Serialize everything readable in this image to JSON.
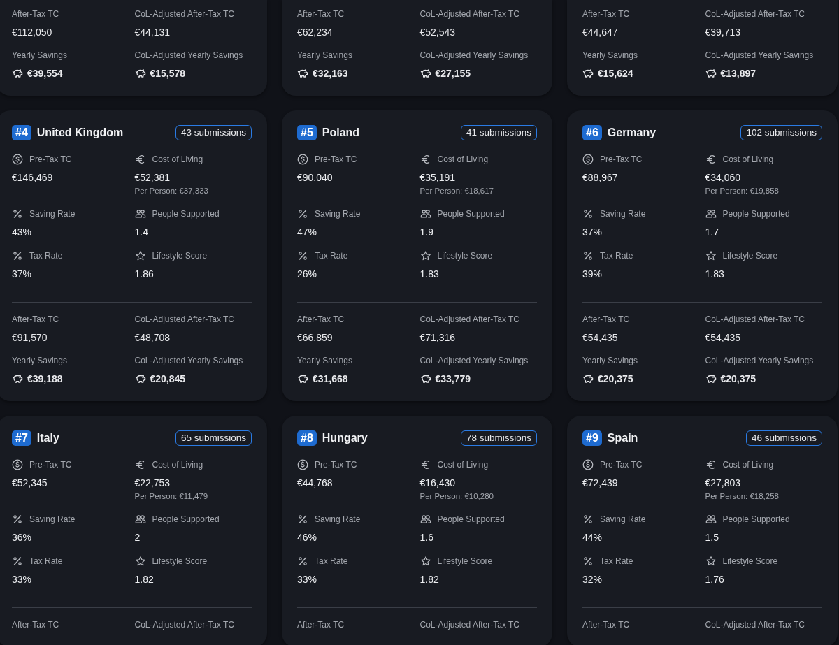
{
  "cards": [
    {
      "summary": [
        {
          "label": "After-Tax TC",
          "value": "€112,050",
          "kind": "amount"
        },
        {
          "label": "CoL-Adjusted After-Tax TC",
          "value": "€44,131",
          "kind": "amount"
        },
        {
          "label": "Yearly Savings",
          "value": "€39,554",
          "kind": "savings"
        },
        {
          "label": "CoL-Adjusted Yearly Savings",
          "value": "€15,578",
          "kind": "savings"
        }
      ]
    },
    {
      "summary": [
        {
          "label": "After-Tax TC",
          "value": "€62,234",
          "kind": "amount"
        },
        {
          "label": "CoL-Adjusted After-Tax TC",
          "value": "€52,543",
          "kind": "amount"
        },
        {
          "label": "Yearly Savings",
          "value": "€32,163",
          "kind": "savings"
        },
        {
          "label": "CoL-Adjusted Yearly Savings",
          "value": "€27,155",
          "kind": "savings"
        }
      ]
    },
    {
      "summary": [
        {
          "label": "After-Tax TC",
          "value": "€44,647",
          "kind": "amount"
        },
        {
          "label": "CoL-Adjusted After-Tax TC",
          "value": "€39,713",
          "kind": "amount"
        },
        {
          "label": "Yearly Savings",
          "value": "€15,624",
          "kind": "savings"
        },
        {
          "label": "CoL-Adjusted Yearly Savings",
          "value": "€13,897",
          "kind": "savings"
        }
      ]
    },
    {
      "rank": "#4",
      "country": "United Kingdom",
      "submissions": "43 submissions",
      "metrics": [
        {
          "kind": "amount",
          "label": "Pre-Tax TC",
          "value": "€146,469"
        },
        {
          "kind": "cost",
          "label": "Cost of Living",
          "value": "€52,381",
          "note": "Per Person: €37,333"
        },
        {
          "kind": "rate",
          "label": "Saving Rate",
          "value": "43%"
        },
        {
          "kind": "count",
          "label": "People Supported",
          "value": "1.4"
        },
        {
          "kind": "rate",
          "label": "Tax Rate",
          "value": "37%"
        },
        {
          "kind": "score",
          "label": "Lifestyle Score",
          "value": "1.86"
        }
      ],
      "summary": [
        {
          "label": "After-Tax TC",
          "value": "€91,570",
          "kind": "amount"
        },
        {
          "label": "CoL-Adjusted After-Tax TC",
          "value": "€48,708",
          "kind": "amount"
        },
        {
          "label": "Yearly Savings",
          "value": "€39,188",
          "kind": "savings"
        },
        {
          "label": "CoL-Adjusted Yearly Savings",
          "value": "€20,845",
          "kind": "savings"
        }
      ]
    },
    {
      "rank": "#5",
      "country": "Poland",
      "submissions": "41 submissions",
      "metrics": [
        {
          "kind": "amount",
          "label": "Pre-Tax TC",
          "value": "€90,040"
        },
        {
          "kind": "cost",
          "label": "Cost of Living",
          "value": "€35,191",
          "note": "Per Person: €18,617"
        },
        {
          "kind": "rate",
          "label": "Saving Rate",
          "value": "47%"
        },
        {
          "kind": "count",
          "label": "People Supported",
          "value": "1.9"
        },
        {
          "kind": "rate",
          "label": "Tax Rate",
          "value": "26%"
        },
        {
          "kind": "score",
          "label": "Lifestyle Score",
          "value": "1.83"
        }
      ],
      "summary": [
        {
          "label": "After-Tax TC",
          "value": "€66,859",
          "kind": "amount"
        },
        {
          "label": "CoL-Adjusted After-Tax TC",
          "value": "€71,316",
          "kind": "amount"
        },
        {
          "label": "Yearly Savings",
          "value": "€31,668",
          "kind": "savings"
        },
        {
          "label": "CoL-Adjusted Yearly Savings",
          "value": "€33,779",
          "kind": "savings"
        }
      ]
    },
    {
      "rank": "#6",
      "country": "Germany",
      "submissions": "102 submissions",
      "metrics": [
        {
          "kind": "amount",
          "label": "Pre-Tax TC",
          "value": "€88,967"
        },
        {
          "kind": "cost",
          "label": "Cost of Living",
          "value": "€34,060",
          "note": "Per Person: €19,858"
        },
        {
          "kind": "rate",
          "label": "Saving Rate",
          "value": "37%"
        },
        {
          "kind": "count",
          "label": "People Supported",
          "value": "1.7"
        },
        {
          "kind": "rate",
          "label": "Tax Rate",
          "value": "39%"
        },
        {
          "kind": "score",
          "label": "Lifestyle Score",
          "value": "1.83"
        }
      ],
      "summary": [
        {
          "label": "After-Tax TC",
          "value": "€54,435",
          "kind": "amount"
        },
        {
          "label": "CoL-Adjusted After-Tax TC",
          "value": "€54,435",
          "kind": "amount"
        },
        {
          "label": "Yearly Savings",
          "value": "€20,375",
          "kind": "savings"
        },
        {
          "label": "CoL-Adjusted Yearly Savings",
          "value": "€20,375",
          "kind": "savings"
        }
      ]
    },
    {
      "rank": "#7",
      "country": "Italy",
      "submissions": "65 submissions",
      "metrics": [
        {
          "kind": "amount",
          "label": "Pre-Tax TC",
          "value": "€52,345"
        },
        {
          "kind": "cost",
          "label": "Cost of Living",
          "value": "€22,753",
          "note": "Per Person: €11,479"
        },
        {
          "kind": "rate",
          "label": "Saving Rate",
          "value": "36%"
        },
        {
          "kind": "count",
          "label": "People Supported",
          "value": "2"
        },
        {
          "kind": "rate",
          "label": "Tax Rate",
          "value": "33%"
        },
        {
          "kind": "score",
          "label": "Lifestyle Score",
          "value": "1.82"
        }
      ],
      "summary": [
        {
          "label": "After-Tax TC"
        },
        {
          "label": "CoL-Adjusted After-Tax TC"
        }
      ]
    },
    {
      "rank": "#8",
      "country": "Hungary",
      "submissions": "78 submissions",
      "metrics": [
        {
          "kind": "amount",
          "label": "Pre-Tax TC",
          "value": "€44,768"
        },
        {
          "kind": "cost",
          "label": "Cost of Living",
          "value": "€16,430",
          "note": "Per Person: €10,280"
        },
        {
          "kind": "rate",
          "label": "Saving Rate",
          "value": "46%"
        },
        {
          "kind": "count",
          "label": "People Supported",
          "value": "1.6"
        },
        {
          "kind": "rate",
          "label": "Tax Rate",
          "value": "33%"
        },
        {
          "kind": "score",
          "label": "Lifestyle Score",
          "value": "1.82"
        }
      ],
      "summary": [
        {
          "label": "After-Tax TC"
        },
        {
          "label": "CoL-Adjusted After-Tax TC"
        }
      ]
    },
    {
      "rank": "#9",
      "country": "Spain",
      "submissions": "46 submissions",
      "metrics": [
        {
          "kind": "amount",
          "label": "Pre-Tax TC",
          "value": "€72,439"
        },
        {
          "kind": "cost",
          "label": "Cost of Living",
          "value": "€27,803",
          "note": "Per Person: €18,258"
        },
        {
          "kind": "rate",
          "label": "Saving Rate",
          "value": "44%"
        },
        {
          "kind": "count",
          "label": "People Supported",
          "value": "1.5"
        },
        {
          "kind": "rate",
          "label": "Tax Rate",
          "value": "32%"
        },
        {
          "kind": "score",
          "label": "Lifestyle Score",
          "value": "1.76"
        }
      ],
      "summary": [
        {
          "label": "After-Tax TC"
        },
        {
          "label": "CoL-Adjusted After-Tax TC"
        }
      ]
    }
  ]
}
